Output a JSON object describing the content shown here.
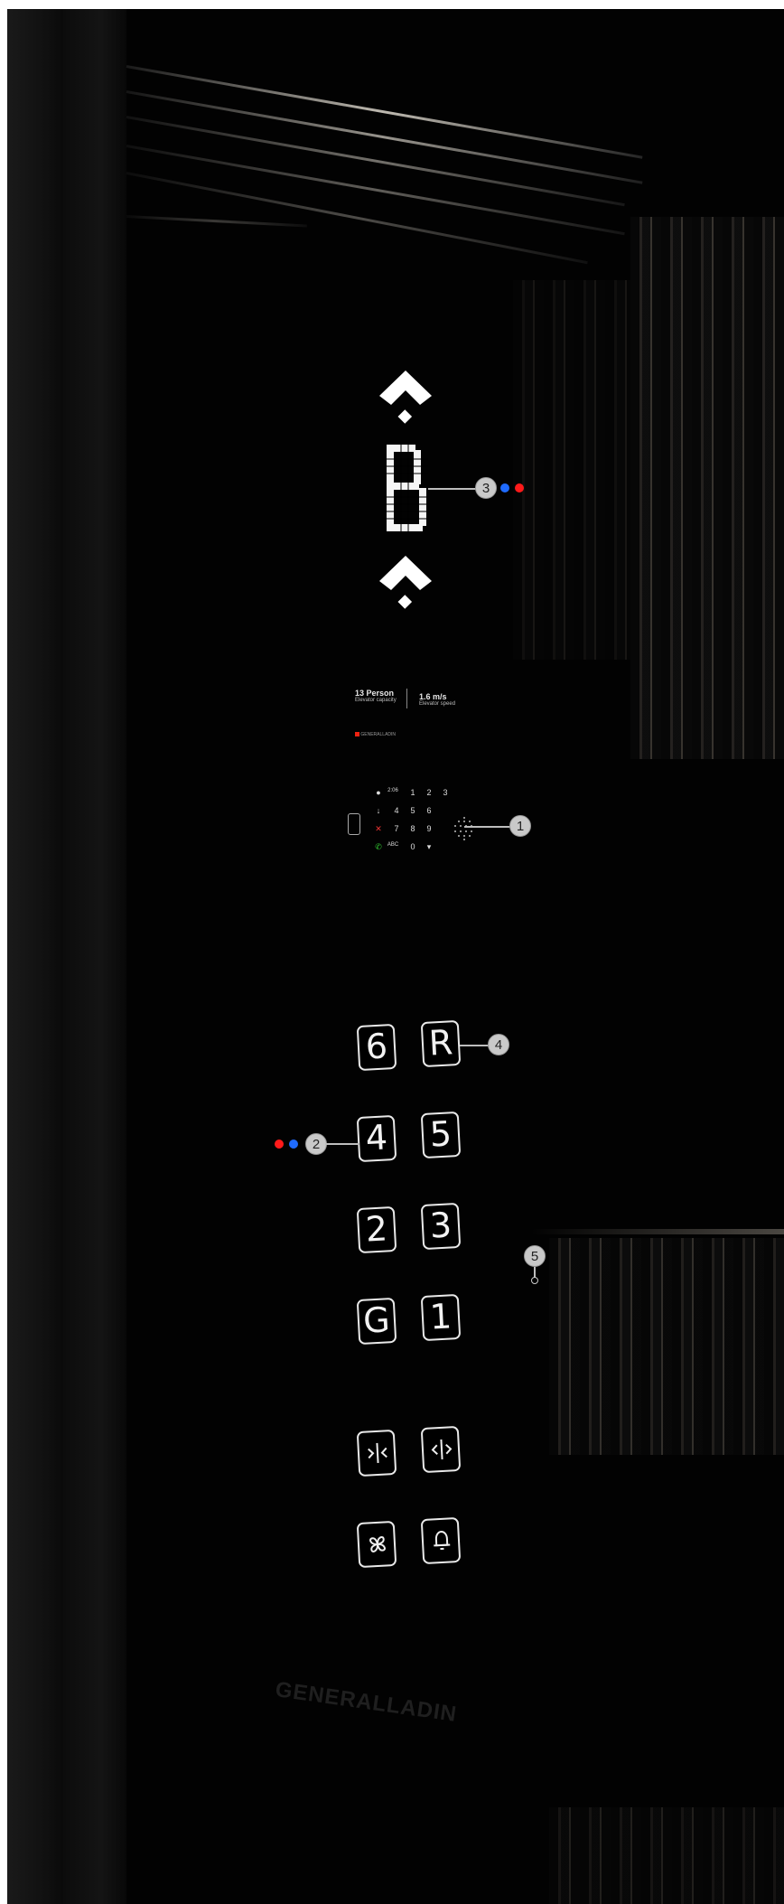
{
  "display": {
    "floor_indicator": "B"
  },
  "info": {
    "capacity_value": "13 Person",
    "capacity_label": "Elevator capacity",
    "speed_value": "1.6 m/s",
    "speed_label": "Elevator speed",
    "brand_small": "GENERALLADIN"
  },
  "keypad": {
    "left_labels": [
      "●",
      "↓",
      "✕",
      "✆"
    ],
    "mid_labels": [
      "2:06",
      "4",
      "7",
      "ABC"
    ],
    "keys": [
      "1",
      "2",
      "3",
      "4",
      "5",
      "6",
      "7",
      "8",
      "9",
      "0"
    ]
  },
  "buttons": {
    "floors": [
      "6",
      "R",
      "4",
      "5",
      "2",
      "3",
      "G",
      "1"
    ],
    "door_close_icon": "door-close-icon",
    "door_open_icon": "door-open-icon",
    "fan_icon": "fan-icon",
    "alarm_icon": "bell-icon"
  },
  "markers": [
    "1",
    "2",
    "3",
    "4",
    "5"
  ],
  "colors": {
    "dot_blue": "#1f6bff",
    "dot_red": "#ff1a1a",
    "marker_fill": "#c9c9c9"
  },
  "watermark": "GENERALLADIN"
}
